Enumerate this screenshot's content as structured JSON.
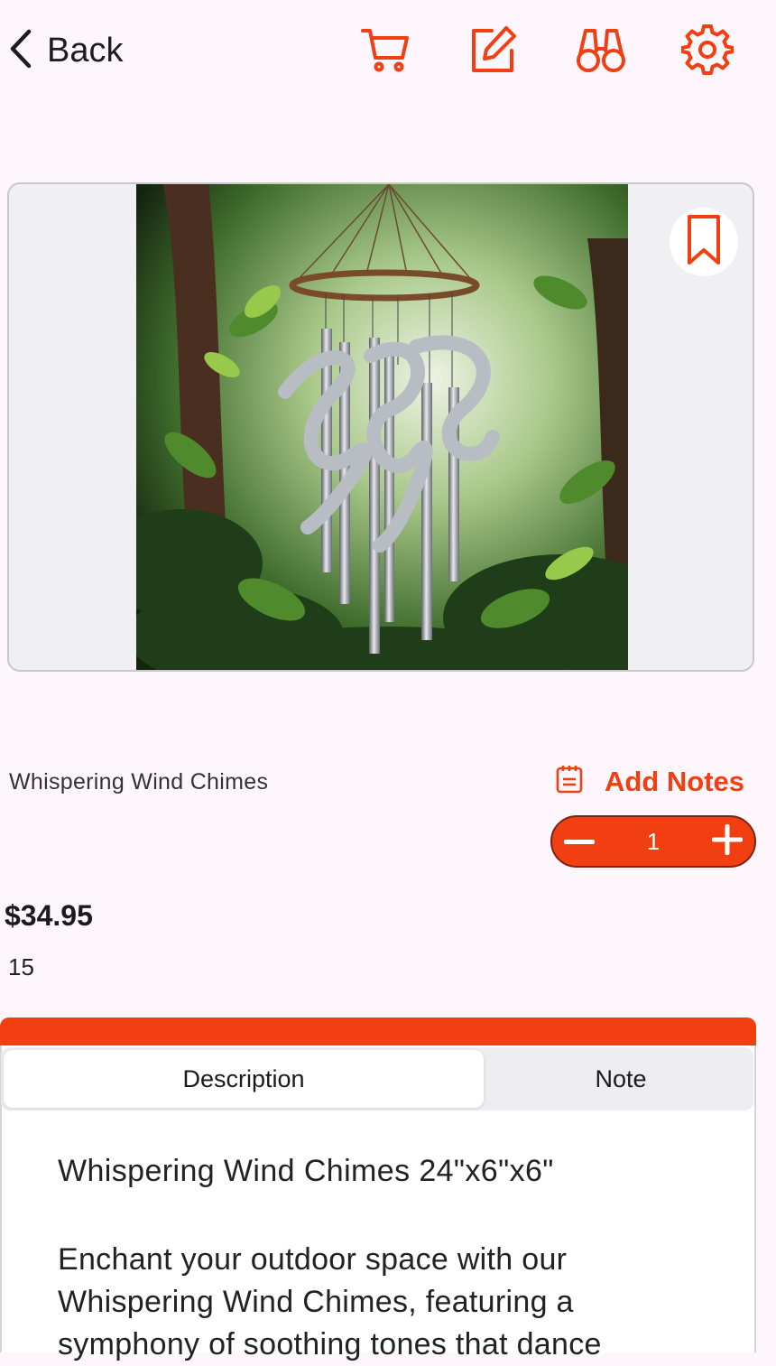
{
  "header": {
    "back_label": "Back",
    "icons": [
      "cart-icon",
      "edit-icon",
      "binoculars-icon",
      "settings-icon"
    ]
  },
  "product": {
    "name": "Whispering Wind Chimes",
    "price": "$34.95",
    "stock": "15",
    "quantity": "1",
    "add_notes_label": "Add Notes"
  },
  "tabs": [
    {
      "label": "Description",
      "active": true
    },
    {
      "label": "Note",
      "active": false
    }
  ],
  "description": {
    "title": "Whispering Wind Chimes 24\"x6\"x6\"",
    "body": "Enchant your outdoor space with our Whispering Wind Chimes, featuring a symphony of soothing tones that dance"
  },
  "colors": {
    "accent": "#f23f12",
    "background": "#fdf7fd",
    "card": "#f0eff3"
  }
}
